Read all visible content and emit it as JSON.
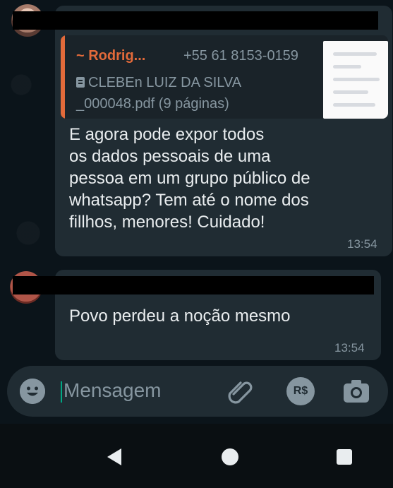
{
  "messages": [
    {
      "sender_hidden": true,
      "quote": {
        "author": "~ Rodrig...",
        "phone": "+55 61 8153-0159",
        "document": "CLEBEn LUIZ DA SILVA\n_000048.pdf (9 páginas)",
        "icon": "document-icon"
      },
      "text": "E agora pode expor todos\nos dados pessoais de uma\npessoa em um grupo público de\nwhatsapp? Tem até o nome dos\nfillhos, menores!  Cuidado!",
      "time": "13:54"
    },
    {
      "sender_hidden": true,
      "text": "Povo perdeu a noção mesmo",
      "time": "13:54"
    }
  ],
  "composer": {
    "placeholder": "Mensagem",
    "icons": [
      "emoji-icon",
      "attach-icon",
      "payment-icon",
      "camera-icon"
    ],
    "payment_label": "R$"
  },
  "navbar": {
    "icons": [
      "back-icon",
      "home-icon",
      "recents-icon"
    ]
  },
  "colors": {
    "background": "#0b141a",
    "bubble": "#202c33",
    "quote_accent": "#e26a3a",
    "secondary_text": "#8696a0",
    "cursor": "#00a884"
  }
}
